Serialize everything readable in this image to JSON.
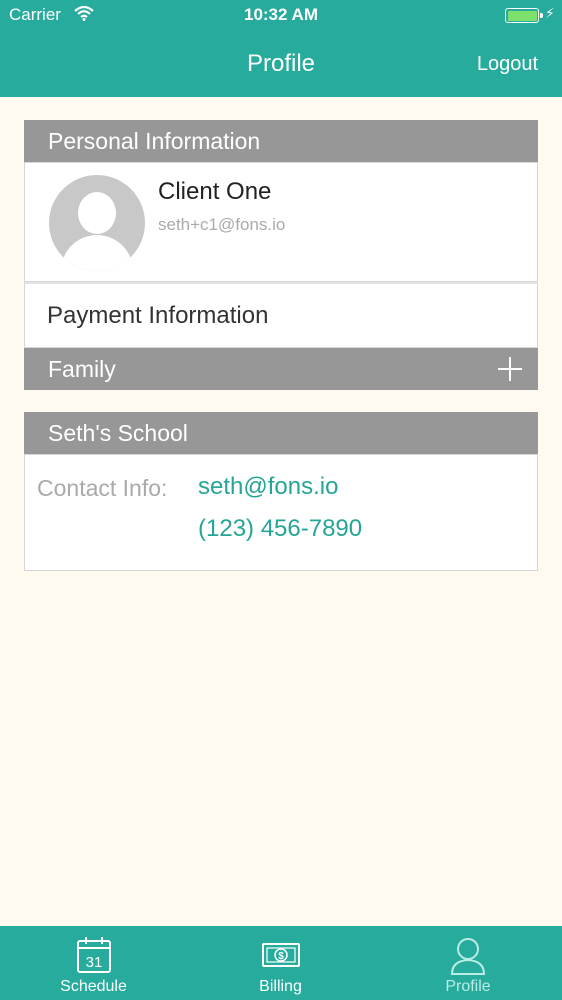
{
  "status_bar": {
    "carrier": "Carrier",
    "time": "10:32 AM"
  },
  "nav": {
    "title": "Profile",
    "logout": "Logout"
  },
  "personal": {
    "header": "Personal Information",
    "name": "Client One",
    "email": "seth+c1@fons.io",
    "avatar_icon": "user-placeholder-icon"
  },
  "payment": {
    "label": "Payment Information"
  },
  "family": {
    "header": "Family",
    "add_icon": "plus-icon"
  },
  "school": {
    "header": "Seth's School",
    "contact_label": "Contact Info:",
    "contact_email": "seth@fons.io",
    "contact_phone": "(123) 456-7890"
  },
  "tabs": [
    {
      "label": "Schedule",
      "icon": "calendar-icon",
      "icon_text": "31",
      "active": false
    },
    {
      "label": "Billing",
      "icon": "dollar-bill-icon",
      "active": false
    },
    {
      "label": "Profile",
      "icon": "user-outline-icon",
      "active": true
    }
  ],
  "colors": {
    "accent": "#26ab9d",
    "section_header": "#979797",
    "background": "#fffaf0",
    "link": "#25a596"
  }
}
